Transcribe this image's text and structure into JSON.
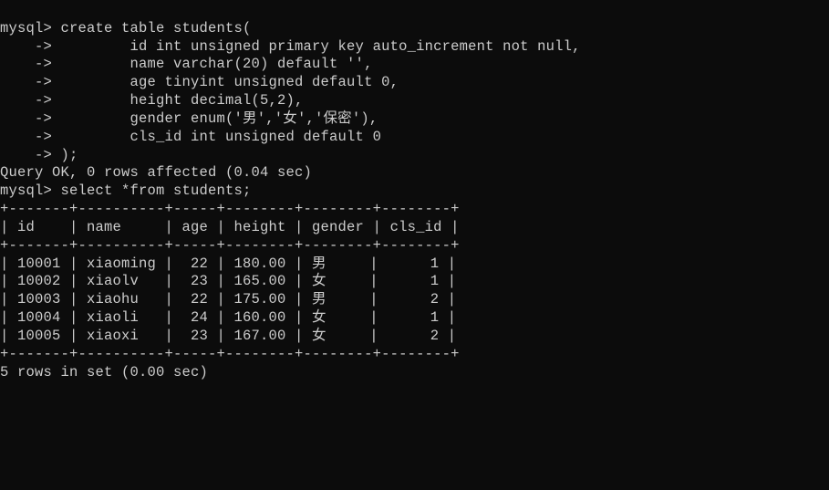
{
  "prompt": "mysql>",
  "continuation": "    ->",
  "sql": {
    "create_lines": [
      "create table students(",
      "    id int unsigned primary key auto_increment not null,",
      "    name varchar(20) default '',",
      "    age tinyint unsigned default 0,",
      "    height decimal(5,2),",
      "    gender enum('男','女','保密'),",
      "    cls_id int unsigned default 0",
      ");"
    ],
    "create_result": "Query OK, 0 rows affected (0.04 sec)",
    "select_stmt": "select *from students;",
    "columns": [
      "id",
      "name",
      "age",
      "height",
      "gender",
      "cls_id"
    ],
    "rows": [
      {
        "id": 10001,
        "name": "xiaoming",
        "age": 22,
        "height": "180.00",
        "gender": "男",
        "cls_id": 1
      },
      {
        "id": 10002,
        "name": "xiaolv",
        "age": 23,
        "height": "165.00",
        "gender": "女",
        "cls_id": 1
      },
      {
        "id": 10003,
        "name": "xiaohu",
        "age": 22,
        "height": "175.00",
        "gender": "男",
        "cls_id": 2
      },
      {
        "id": 10004,
        "name": "xiaoli",
        "age": 24,
        "height": "160.00",
        "gender": "女",
        "cls_id": 1
      },
      {
        "id": 10005,
        "name": "xiaoxi",
        "age": 23,
        "height": "167.00",
        "gender": "女",
        "cls_id": 2
      }
    ],
    "select_result": "5 rows in set (0.00 sec)"
  },
  "col_widths": {
    "id": 7,
    "name": 10,
    "age": 5,
    "height": 8,
    "gender": 8,
    "cls_id": 8
  }
}
